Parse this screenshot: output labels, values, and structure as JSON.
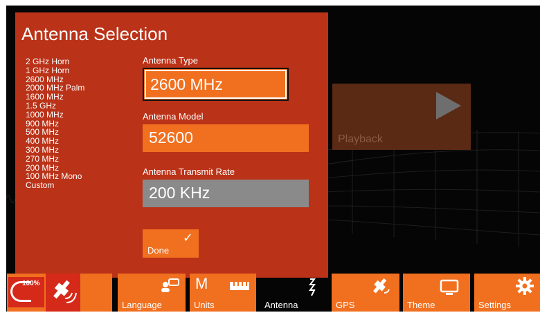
{
  "dialog": {
    "title": "Antenna Selection",
    "antenna_list": [
      "2 GHz Horn",
      "1 GHz Horn",
      "2600 MHz",
      "2000 MHz Palm",
      "1600 MHz",
      "1.5 GHz",
      "1000 MHz",
      "900 MHz",
      "500 MHz",
      "400 MHz",
      "300 MHz",
      "270 MHz",
      "200 MHz",
      "100 MHz Mono",
      "Custom"
    ],
    "antenna_type_label": "Antenna Type",
    "antenna_type_value": "2600 MHz",
    "antenna_model_label": "Antenna Model",
    "antenna_model_value": "52600",
    "transmit_rate_label": "Antenna Transmit Rate",
    "transmit_rate_value": "200 KHz",
    "done_label": "Done"
  },
  "background": {
    "playback_label": "Playback"
  },
  "toolbar": {
    "battery_percent": "100%",
    "language_label": "Language",
    "units_label": "Units",
    "units_letter": "M",
    "antenna_label": "Antenna",
    "gps_label": "GPS",
    "theme_label": "Theme",
    "settings_label": "Settings"
  },
  "colors": {
    "dialog_bg": "#ba3218",
    "accent_orange": "#f07020",
    "disabled_gray": "#8a8a8a",
    "background": "#050505"
  }
}
